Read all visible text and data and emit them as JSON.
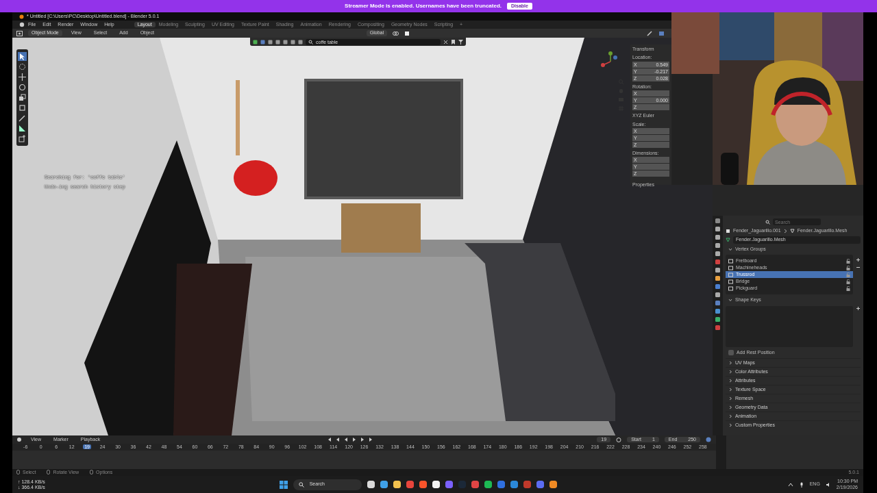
{
  "banner": {
    "text": "Streamer Mode is enabled. Usernames have been truncated.",
    "button": "Disable"
  },
  "window": {
    "title": "* Untitled [C:\\Users\\PC\\Desktop\\Untitled.blend] - Blender 5.0.1"
  },
  "menu": [
    "File",
    "Edit",
    "Render",
    "Window",
    "Help"
  ],
  "workspaces": [
    {
      "label": "Layout",
      "selected": true
    },
    {
      "label": "Modeling",
      "selected": false
    },
    {
      "label": "Sculpting",
      "selected": false
    },
    {
      "label": "UV Editing",
      "selected": false
    },
    {
      "label": "Texture Paint",
      "selected": false
    },
    {
      "label": "Shading",
      "selected": false
    },
    {
      "label": "Animation",
      "selected": false
    },
    {
      "label": "Rendering",
      "selected": false
    },
    {
      "label": "Compositing",
      "selected": false
    },
    {
      "label": "Geometry Nodes",
      "selected": false
    },
    {
      "label": "Scripting",
      "selected": false
    }
  ],
  "add_workspace": "+",
  "viewport": {
    "mode": "Object Mode",
    "menus": [
      "View",
      "Select",
      "Add",
      "Object"
    ],
    "orientation": "Global",
    "search": {
      "value": "coffe table"
    },
    "messages": [
      "Searching for: 'coffe table'",
      "Undo-ing search history step"
    ],
    "scene": {
      "kind": "picture"
    }
  },
  "n_panel": {
    "title": "Transform",
    "sections": [
      {
        "label": "Location:",
        "fields": [
          {
            "axis": "X",
            "value": "0.549"
          },
          {
            "axis": "Y",
            "value": "-0.217"
          },
          {
            "axis": "Z",
            "value": "0.028"
          }
        ]
      },
      {
        "label": "Rotation:",
        "fields": [
          {
            "axis": "X"
          },
          {
            "axis": "Y",
            "value": "0.000"
          },
          {
            "axis": "Z"
          }
        ]
      },
      {
        "label": "XYZ Euler"
      },
      {
        "label": "Scale:",
        "fields": [
          {
            "axis": "X"
          },
          {
            "axis": "Y"
          },
          {
            "axis": "Z"
          }
        ]
      },
      {
        "label": "Dimensions:",
        "fields": [
          {
            "axis": "X"
          },
          {
            "axis": "Y"
          },
          {
            "axis": "Z"
          }
        ]
      }
    ],
    "footer": "Properties"
  },
  "webcam": {
    "kind": "picture"
  },
  "properties": {
    "search_placeholder": "Search",
    "object": "Fender_Jaguarillo.001",
    "mesh": "Fender.Jaguarillo.Mesh",
    "mesh_field": "Fender.Jaguarillo.Mesh",
    "vertex_groups": {
      "title": "Vertex Groups",
      "expanded": true,
      "items": [
        {
          "label": "Fretboard",
          "selected": false
        },
        {
          "label": "Machineheads",
          "selected": false
        },
        {
          "label": "Trussrod",
          "selected": true
        },
        {
          "label": "Bridge",
          "selected": false
        },
        {
          "label": "Pickguard",
          "selected": false
        }
      ]
    },
    "shape_keys": {
      "title": "Shape Keys",
      "expanded": true
    },
    "add_rest_position": {
      "label": "Add Rest Position",
      "checked": false
    },
    "panels": [
      {
        "label": "UV Maps",
        "expanded": false
      },
      {
        "label": "Color Attributes",
        "expanded": false
      },
      {
        "label": "Attributes",
        "expanded": false
      },
      {
        "label": "Texture Space",
        "expanded": false
      },
      {
        "label": "Remesh",
        "expanded": false
      },
      {
        "label": "Geometry Data",
        "expanded": false
      },
      {
        "label": "Animation",
        "expanded": false
      },
      {
        "label": "Custom Properties",
        "expanded": false
      }
    ]
  },
  "timeline": {
    "menus": [
      "View",
      "Marker",
      "Playback"
    ],
    "current_frame": "19",
    "start_label": "Start",
    "start": "1",
    "end_label": "End",
    "end": "250",
    "ticks": [
      "-6",
      "0",
      "6",
      "12",
      "24",
      "30",
      "36",
      "42",
      "48",
      "54",
      "60",
      "66",
      "72",
      "78",
      "84",
      "90",
      "96",
      "102",
      "108",
      "114",
      "120",
      "126",
      "132",
      "138",
      "144",
      "150",
      "156",
      "162",
      "168",
      "174",
      "180",
      "186",
      "192",
      "198",
      "204",
      "210",
      "216",
      "222",
      "228",
      "234",
      "240",
      "246",
      "252",
      "258"
    ],
    "playhead": {
      "label": "19",
      "level": 0.095
    }
  },
  "status_bar": {
    "hints": [
      "Select",
      "Rotate View",
      "Options"
    ],
    "version": "5.0.1"
  },
  "taskbar": {
    "net": [
      "↑ 128.4 KB/s",
      "↓ 366.4 KB/s"
    ],
    "search": "Search",
    "apps": [
      {
        "color": "#d9d9d9"
      },
      {
        "color": "#3fa0e8"
      },
      {
        "color": "#f2c14e"
      },
      {
        "color": "#e8453c"
      },
      {
        "color": "#fb542b"
      },
      {
        "color": "#f3f3f3"
      },
      {
        "color": "#7b61ff"
      },
      {
        "color": "#1b2838"
      },
      {
        "color": "#e04545"
      },
      {
        "color": "#1db954"
      },
      {
        "color": "#2f6fdf"
      },
      {
        "color": "#2b88d8"
      },
      {
        "color": "#c0392b"
      },
      {
        "color": "#5b6cf2"
      },
      {
        "color": "#f08a24"
      }
    ],
    "language": "ENG",
    "time": "10:30 PM",
    "date": "2/19/2026"
  }
}
